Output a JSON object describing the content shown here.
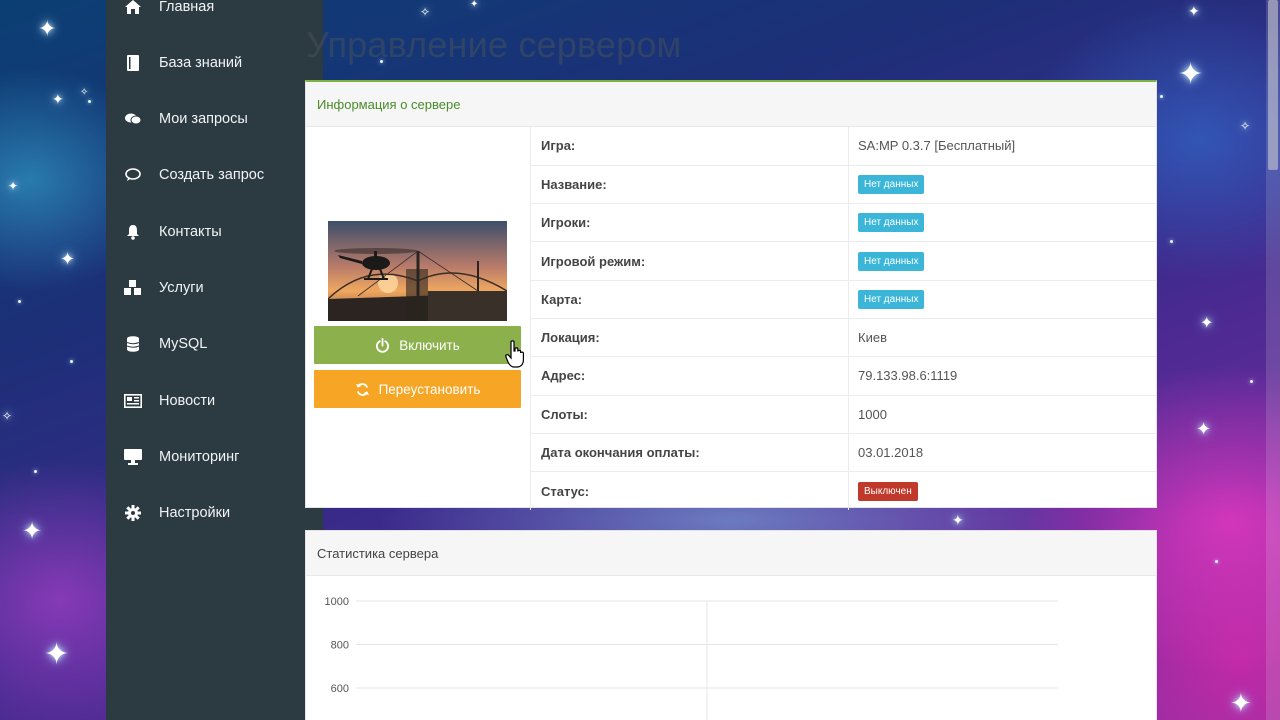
{
  "page": {
    "title": "Управление сервером"
  },
  "sidebar": {
    "items": [
      {
        "label": "Главная",
        "icon": "home-icon"
      },
      {
        "label": "База знаний",
        "icon": "book-icon"
      },
      {
        "label": "Мои запросы",
        "icon": "chat-bubbles-icon"
      },
      {
        "label": "Создать запрос",
        "icon": "chat-bubble-icon"
      },
      {
        "label": "Контакты",
        "icon": "bell-icon"
      },
      {
        "label": "Услуги",
        "icon": "cubes-icon"
      },
      {
        "label": "MySQL",
        "icon": "database-icon"
      },
      {
        "label": "Новости",
        "icon": "newspaper-icon"
      },
      {
        "label": "Мониторинг",
        "icon": "desktop-icon"
      },
      {
        "label": "Настройки",
        "icon": "gear-icon"
      }
    ]
  },
  "server_info": {
    "panel_title": "Информация о сервере",
    "buttons": {
      "start": "Включить",
      "reinstall": "Переустановить"
    },
    "rows": [
      {
        "key": "Игра:",
        "value": "SA:MP 0.3.7 [Бесплатный]",
        "badge": ""
      },
      {
        "key": "Название:",
        "value": "Нет данных",
        "badge": "info"
      },
      {
        "key": "Игроки:",
        "value": "Нет данных",
        "badge": "info"
      },
      {
        "key": "Игровой режим:",
        "value": "Нет данных",
        "badge": "info"
      },
      {
        "key": "Карта:",
        "value": "Нет данных",
        "badge": "info"
      },
      {
        "key": "Локация:",
        "value": "Киев",
        "badge": ""
      },
      {
        "key": "Адрес:",
        "value": "79.133.98.6:1119",
        "badge": ""
      },
      {
        "key": "Слоты:",
        "value": "1000",
        "badge": ""
      },
      {
        "key": "Дата окончания оплаты:",
        "value": "03.01.2018",
        "badge": ""
      },
      {
        "key": "Статус:",
        "value": "Выключен",
        "badge": "off"
      }
    ]
  },
  "stats": {
    "panel_title": "Статистика сервера"
  },
  "chart_data": {
    "type": "line",
    "title": "",
    "xlabel": "",
    "ylabel": "",
    "y_ticks": [
      1000,
      800,
      600
    ],
    "ylim": [
      600,
      1000
    ],
    "grid": true,
    "series": []
  },
  "colors": {
    "sidebar_bg": "#2c3a42",
    "success": "#8cb04c",
    "warning": "#f6a524",
    "info_badge": "#3bb6d8",
    "danger_badge": "#c0392b",
    "panel_accent": "#7cb342"
  }
}
